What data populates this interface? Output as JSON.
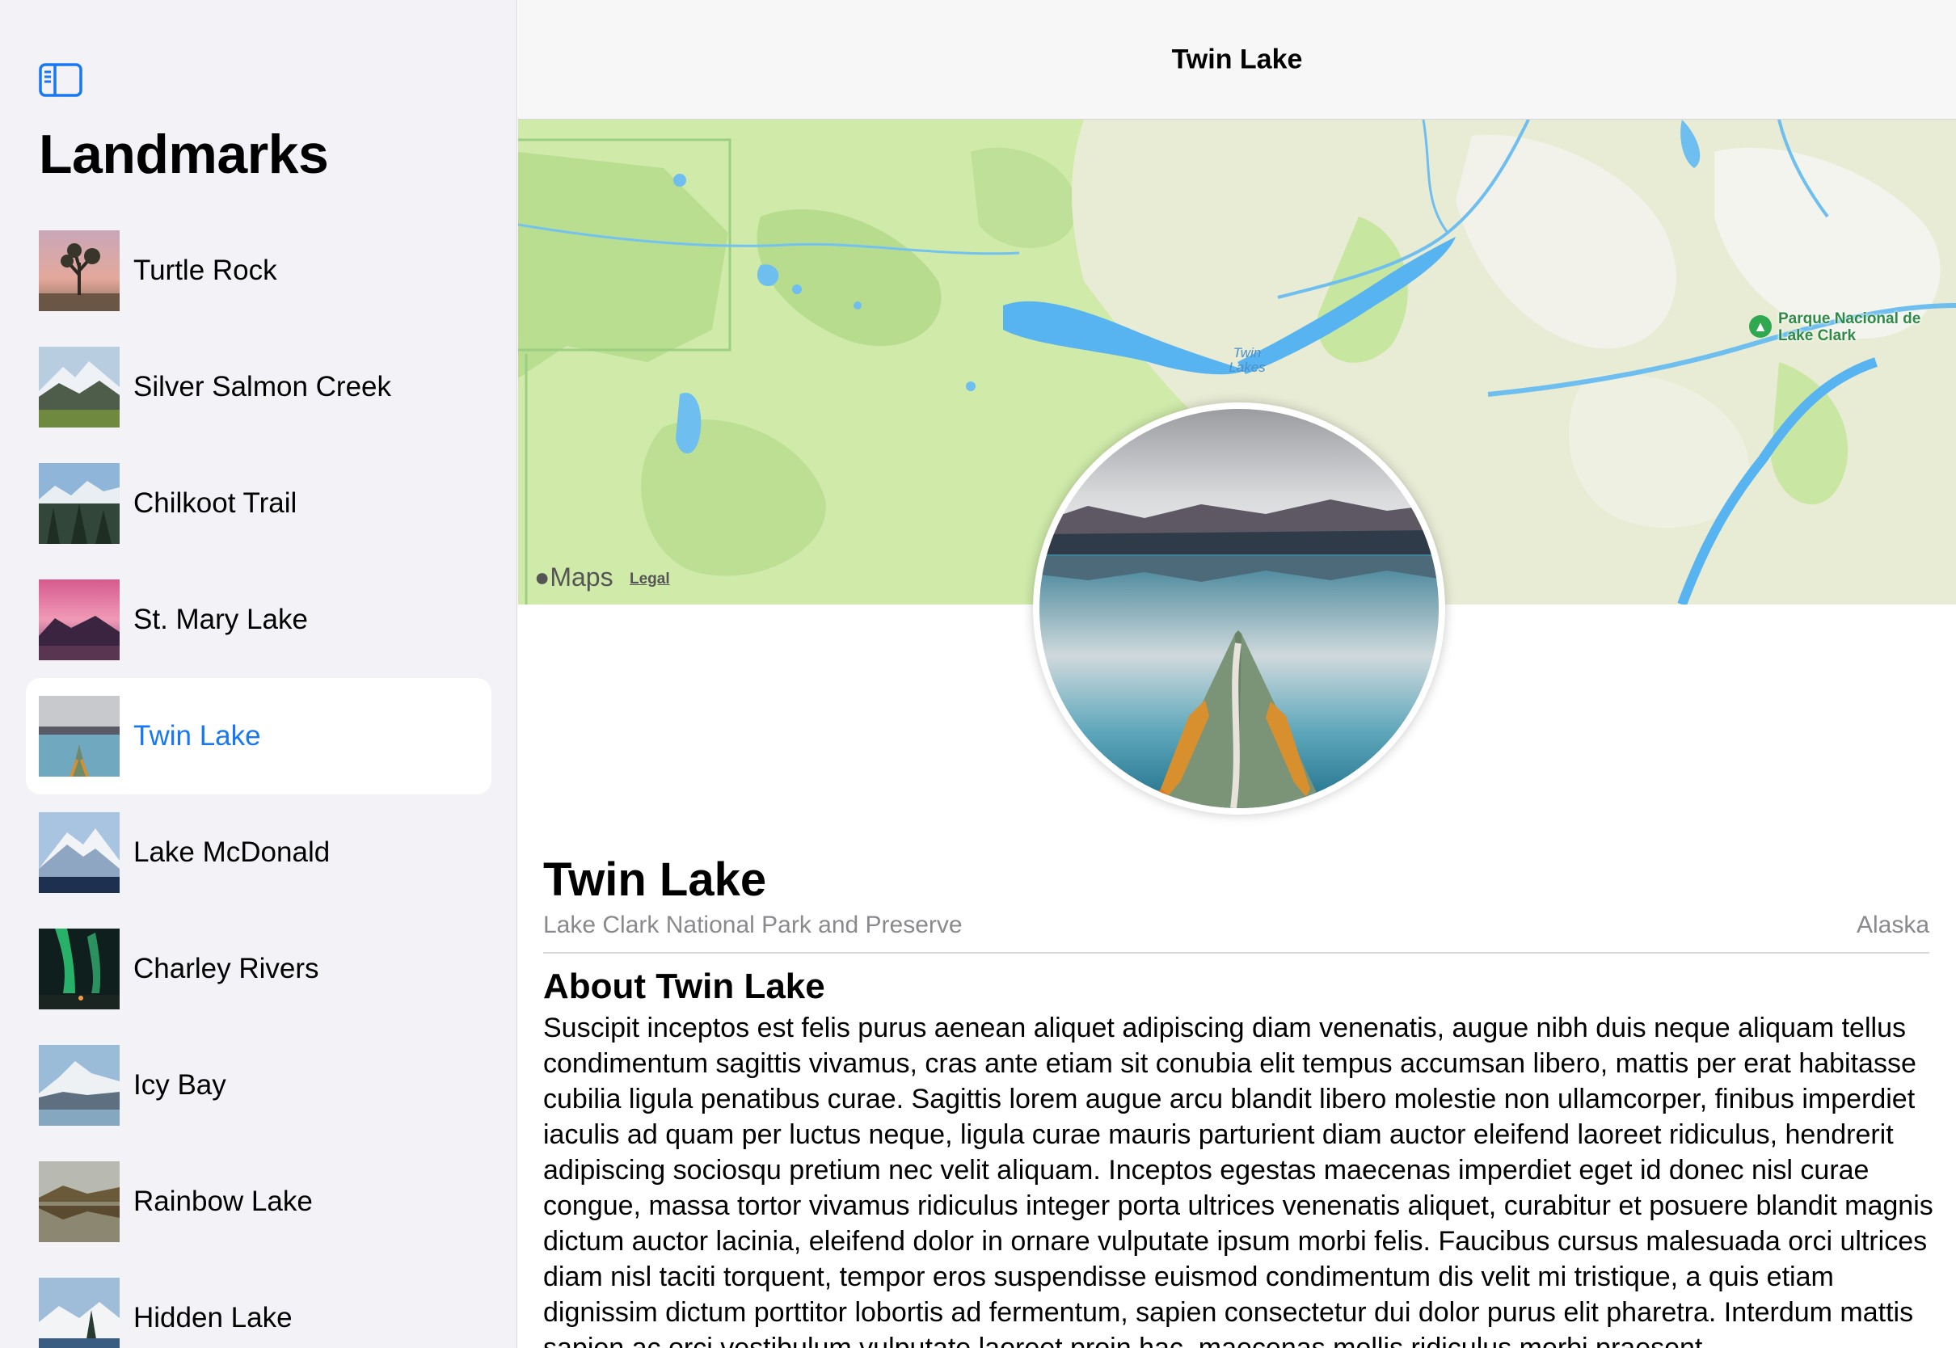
{
  "sidebar": {
    "toggle_icon": "sidebar-toggle-icon",
    "title": "Landmarks",
    "items": [
      {
        "label": "Turtle Rock",
        "selected": false
      },
      {
        "label": "Silver Salmon Creek",
        "selected": false
      },
      {
        "label": "Chilkoot Trail",
        "selected": false
      },
      {
        "label": "St. Mary Lake",
        "selected": false
      },
      {
        "label": "Twin Lake",
        "selected": true
      },
      {
        "label": "Lake McDonald",
        "selected": false
      },
      {
        "label": "Charley Rivers",
        "selected": false
      },
      {
        "label": "Icy Bay",
        "selected": false
      },
      {
        "label": "Rainbow Lake",
        "selected": false
      },
      {
        "label": "Hidden Lake",
        "selected": false
      }
    ]
  },
  "nav": {
    "title": "Twin Lake"
  },
  "map": {
    "brand": "Maps",
    "legal": "Legal",
    "lake_label": "Twin Lakes",
    "poi_label": "Parque Nacional de Lake Clark",
    "poi_icon": "tree-icon"
  },
  "detail": {
    "title": "Twin Lake",
    "park": "Lake Clark National Park and Preserve",
    "state": "Alaska",
    "about_heading": "About Twin Lake",
    "about_body": "Suscipit inceptos est felis purus aenean aliquet adipiscing diam venenatis, augue nibh duis neque aliquam tellus condimentum sagittis vivamus, cras ante etiam sit conubia elit tempus accumsan libero, mattis per erat habitasse cubilia ligula penatibus curae. Sagittis lorem augue arcu blandit libero molestie non ullamcorper, finibus imperdiet iaculis ad quam per luctus neque, ligula curae mauris parturient diam auctor eleifend laoreet ridiculus, hendrerit adipiscing sociosqu pretium nec velit aliquam. Inceptos egestas maecenas imperdiet eget id donec nisl curae congue, massa tortor vivamus ridiculus integer porta ultrices venenatis aliquet, curabitur et posuere blandit magnis dictum auctor lacinia, eleifend dolor in ornare vulputate ipsum morbi felis. Faucibus cursus malesuada orci ultrices diam nisl taciti torquent, tempor eros suspendisse euismod condimentum dis velit mi tristique, a quis etiam dignissim dictum porttitor lobortis ad fermentum, sapien consectetur dui dolor purus elit pharetra. Interdum mattis sapien ac orci vestibulum vulputate laoreet proin hac, maecenas mollis ridiculus morbi praesent"
  },
  "colors": {
    "accent": "#1877f2",
    "sidebar_bg": "#f2f2f7",
    "secondary_text": "#8a8a8e",
    "map_green": "#cdeaa8",
    "water": "#58b4f0"
  }
}
